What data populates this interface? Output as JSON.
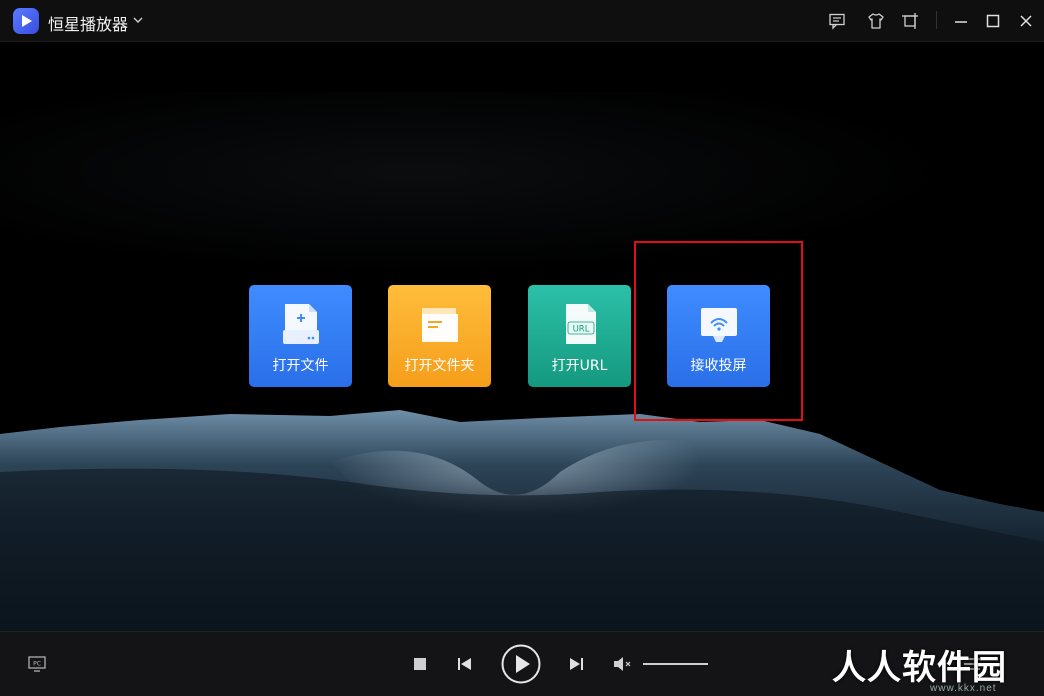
{
  "app": {
    "title": "恒星播放器"
  },
  "titlebar": {
    "icons": [
      "feedback-icon",
      "skin-icon",
      "pin-icon",
      "minimize-icon",
      "maximize-icon",
      "close-icon"
    ]
  },
  "tiles": [
    {
      "label": "打开文件",
      "color": "#3f8cff",
      "icon": "open-file-icon"
    },
    {
      "label": "打开文件夹",
      "color": "#ffbd3a",
      "icon": "open-folder-icon"
    },
    {
      "label": "打开URL",
      "color": "#2cc0a8",
      "icon": "open-url-icon",
      "badge": "URL"
    },
    {
      "label": "接收投屏",
      "color": "#3f8cff",
      "icon": "cast-receive-icon"
    }
  ],
  "controls": {
    "pc_badge": "PC",
    "volume_level": 1.0,
    "icons": [
      "pc-icon",
      "stop-icon",
      "previous-icon",
      "play-icon",
      "next-icon",
      "mute-icon",
      "playlist-icon"
    ]
  },
  "watermark": {
    "text": "人人软件园",
    "url": "www.kkx.net"
  },
  "colors": {
    "highlight": "#e01010",
    "titlebar_bg": "#0f0f10",
    "controlbar_bg": "#141416"
  }
}
